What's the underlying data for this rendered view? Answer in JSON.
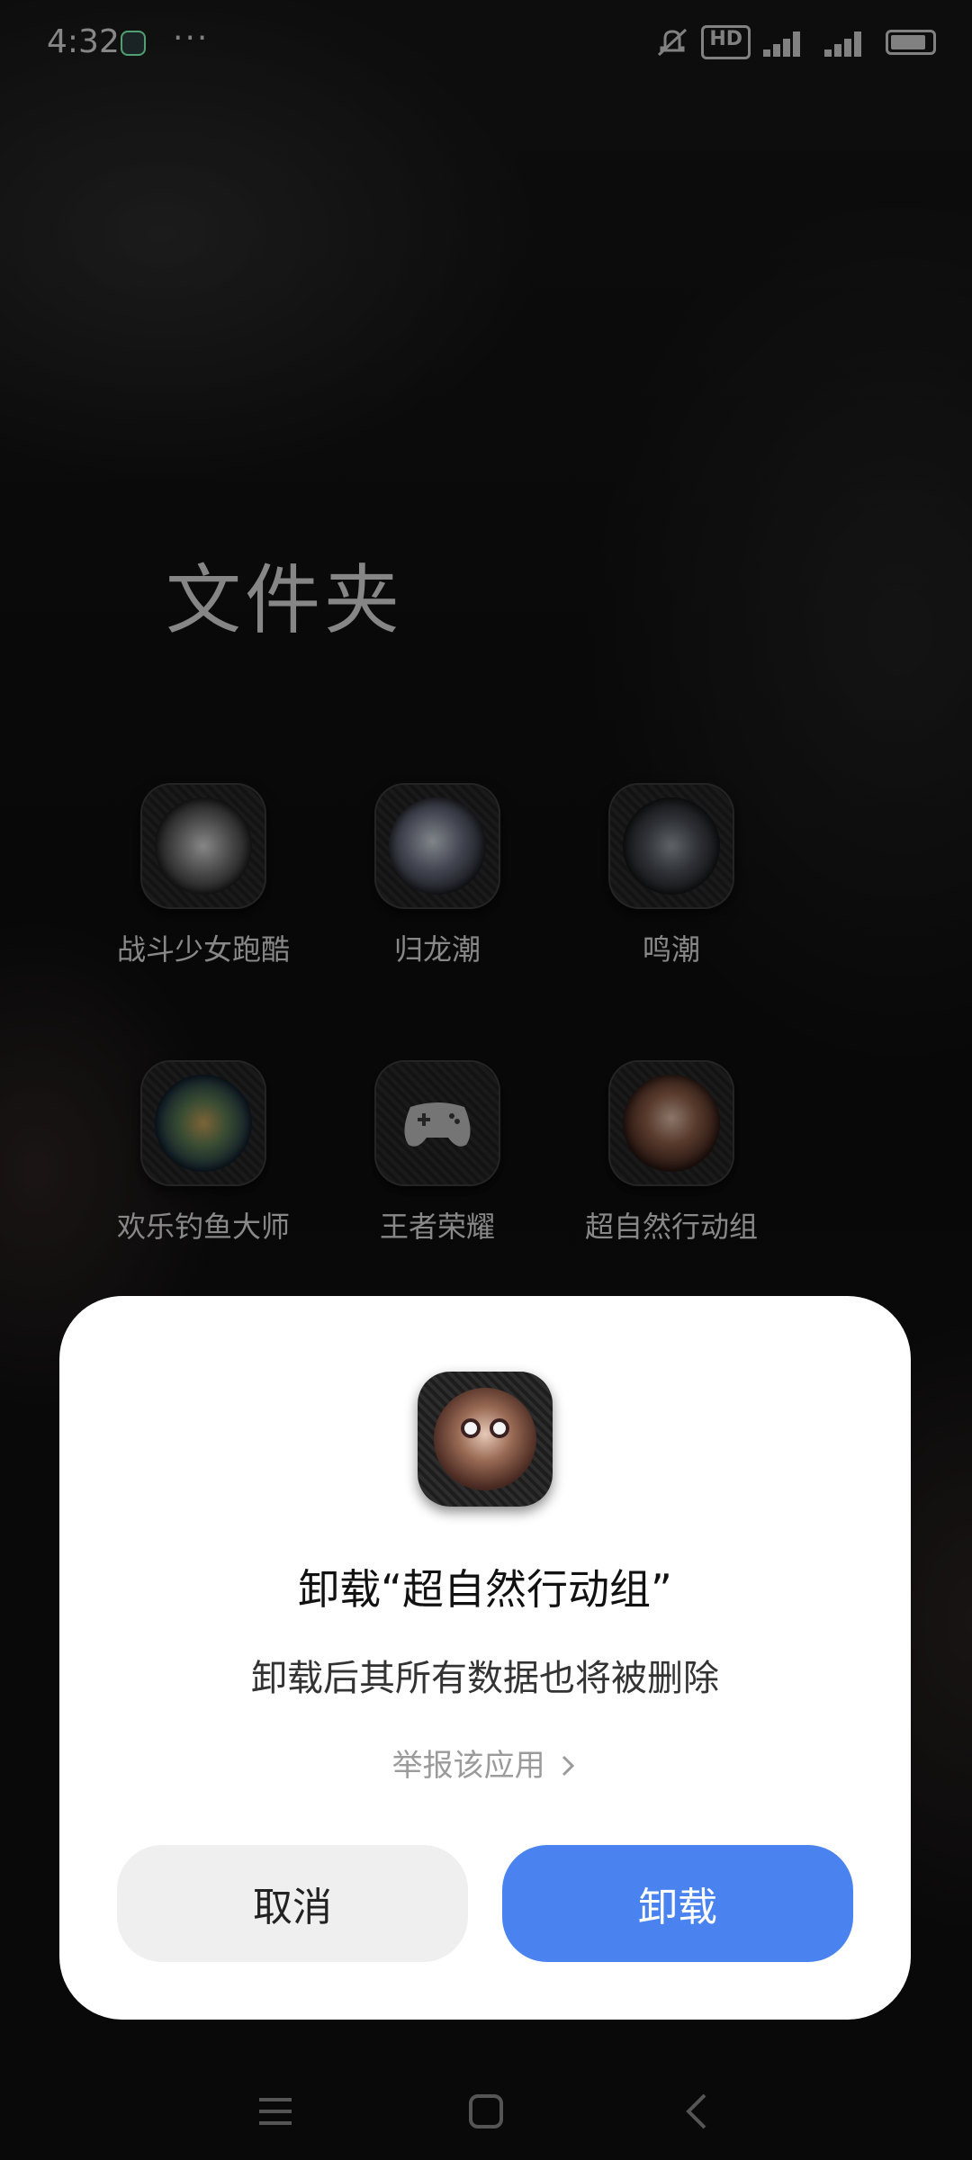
{
  "status_bar": {
    "time": "4:32",
    "more": "···",
    "hd_label": "HD",
    "icons": [
      "app-notification-icon",
      "more-icon",
      "mute-icon",
      "hd-icon",
      "signal-5g-icon",
      "signal-icon",
      "battery-icon"
    ]
  },
  "folder": {
    "title": "文件夹",
    "apps": [
      {
        "label": "战斗少女跑酷",
        "icon": "battle-girl-app-icon"
      },
      {
        "label": "归龙潮",
        "icon": "guilongchao-app-icon"
      },
      {
        "label": "鸣潮",
        "icon": "mingchao-app-icon"
      },
      {
        "label": "欢乐钓鱼大师",
        "icon": "fishing-app-icon"
      },
      {
        "label": "王者荣耀",
        "icon": "gamepad-app-icon"
      },
      {
        "label": "超自然行动组",
        "icon": "supernatural-app-icon"
      }
    ]
  },
  "dialog": {
    "title": "卸载“超自然行动组”",
    "description": "卸载后其所有数据也将被删除",
    "report_link": "举报该应用",
    "cancel_label": "取消",
    "uninstall_label": "卸载",
    "accent_color": "#4a83f0"
  },
  "nav_bar": {
    "icons": [
      "menu-icon",
      "home-icon",
      "back-icon"
    ]
  }
}
